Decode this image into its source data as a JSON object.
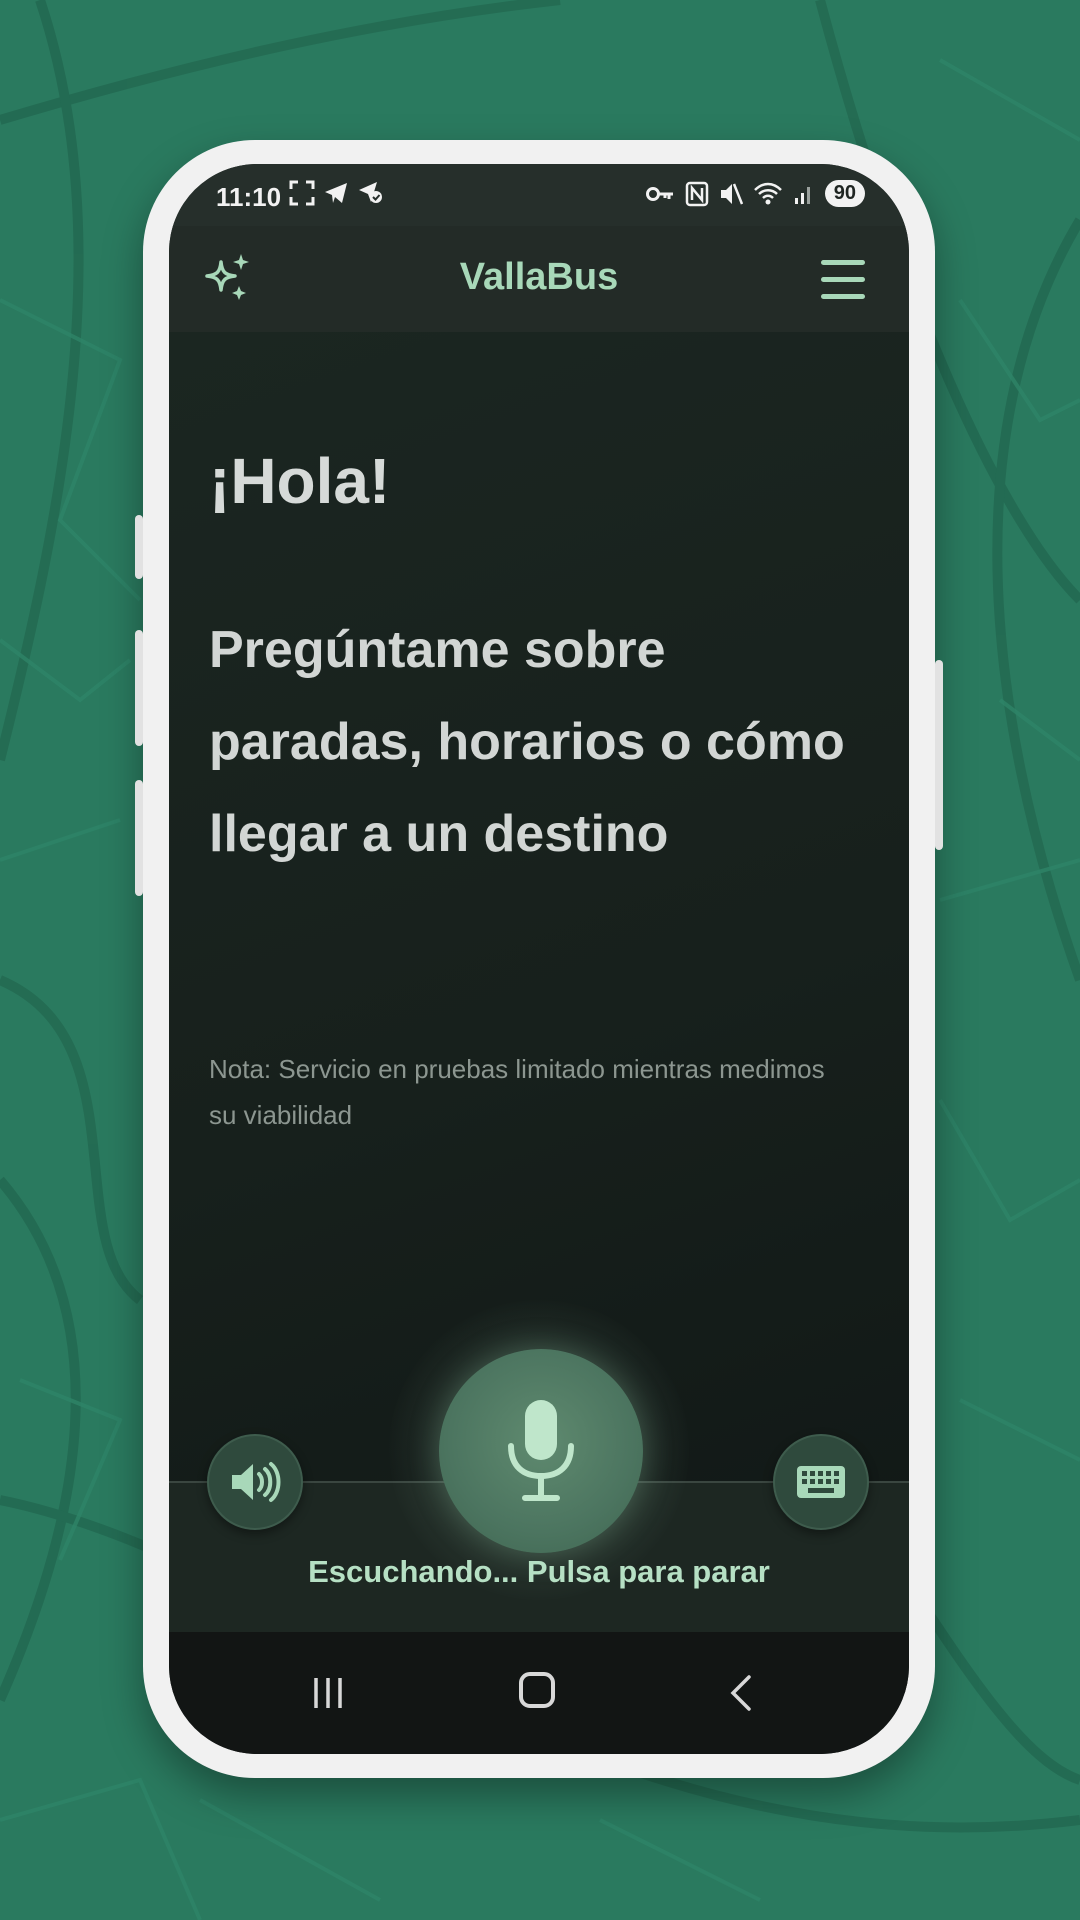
{
  "colors": {
    "background": "#2a7a5f",
    "accent": "#a8d8b9",
    "screen": "#1b2520"
  },
  "status_bar": {
    "time": "11:10",
    "battery": "90",
    "left_icons": [
      "screenshot-icon",
      "telegram-icon",
      "location-check-icon"
    ],
    "right_icons": [
      "vpn-key-icon",
      "nfc-icon",
      "mute-icon",
      "wifi-icon",
      "signal-icon"
    ]
  },
  "header": {
    "title": "VallaBus",
    "left_icon": "sparkle-icon",
    "right_icon": "menu-icon"
  },
  "main": {
    "greeting": "¡Hola!",
    "prompt": "Pregúntame sobre paradas, horarios o cómo llegar a un destino",
    "note": "Nota: Servicio en pruebas limitado mientras medimos su viabilidad"
  },
  "controls": {
    "speaker_icon": "speaker-icon",
    "mic_icon": "microphone-icon",
    "keyboard_icon": "keyboard-icon",
    "status_label": "Escuchando... Pulsa para parar"
  },
  "nav": {
    "icons": [
      "recents-icon",
      "home-icon",
      "back-icon"
    ]
  }
}
